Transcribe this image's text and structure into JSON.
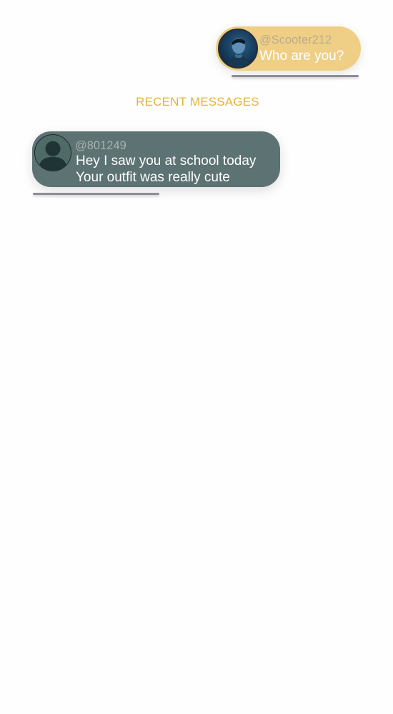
{
  "outgoing_message": {
    "handle": "@Scooter212",
    "text": "Who are you?"
  },
  "section": {
    "title": "RECENT MESSAGES"
  },
  "recent_messages": [
    {
      "handle": "@801249",
      "lines": [
        "Hey I saw you at school today",
        "Your outfit was really cute"
      ]
    }
  ],
  "colors": {
    "outgoing_bubble": "#efcf86",
    "incoming_bubble": "#5d7272",
    "accent_heading": "#e4b43a",
    "underline": "#8f8c98"
  },
  "icons": {
    "outgoing_avatar": "user-photo-avatar",
    "incoming_avatar": "default-user-icon"
  }
}
